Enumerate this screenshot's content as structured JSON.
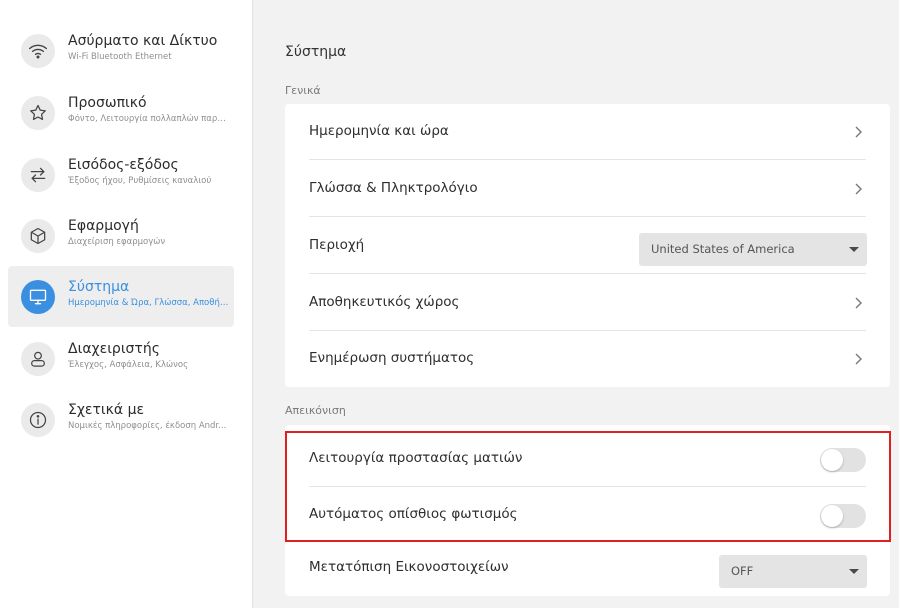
{
  "sidebar": {
    "items": [
      {
        "title": "Ασύρματο και Δίκτυο",
        "subtitle": "Wi-Fi Bluetooth Ethernet",
        "icon": "wifi-icon"
      },
      {
        "title": "Προσωπικό",
        "subtitle": "Φόντο, Λειτουργία πολλαπλών παρα...",
        "icon": "star-icon"
      },
      {
        "title": "Εισόδος-εξόδος",
        "subtitle": "Έξοδος ήχου, Ρυθμίσεις καναλιού",
        "icon": "swap-arrows-icon"
      },
      {
        "title": "Εφαρμογή",
        "subtitle": "Διαχείριση εφαρμογών",
        "icon": "app-cube-icon"
      },
      {
        "title": "Σύστημα",
        "subtitle": "Ημερομηνία & Ώρα, Γλώσσα, Αποθήκ...",
        "icon": "monitor-icon",
        "active": true
      },
      {
        "title": "Διαχειριστής",
        "subtitle": "Έλεγχος, Ασφάλεια, Κλώνος",
        "icon": "user-icon"
      },
      {
        "title": "Σχετικά με",
        "subtitle": "Νομικές πληροφορίες, έκδοση Andr...",
        "icon": "info-icon"
      }
    ]
  },
  "main": {
    "title": "Σύστημα",
    "general": {
      "label": "Γενικά",
      "rows": [
        {
          "label": "Ημερομηνία και ώρα",
          "control": "chevron"
        },
        {
          "label": "Γλώσσα & Πληκτρολόγιο",
          "control": "chevron"
        },
        {
          "label": "Περιοχή",
          "control": "select",
          "value": "United States of America"
        },
        {
          "label": "Αποθηκευτικός χώρος",
          "control": "chevron"
        },
        {
          "label": "Ενημέρωση συστήματος",
          "control": "chevron"
        }
      ]
    },
    "display": {
      "label": "Απεικόνιση",
      "rows": [
        {
          "label": "Λειτουργία προστασίας ματιών",
          "control": "toggle",
          "on": false
        },
        {
          "label": "Αυτόματος οπίσθιος φωτισμός",
          "control": "toggle",
          "on": false
        },
        {
          "label": "Μετατόπιση Εικονοστοιχείων",
          "control": "select",
          "value": "OFF"
        }
      ]
    }
  },
  "colors": {
    "accent": "#3a8fe0",
    "highlight": "#e02020"
  }
}
